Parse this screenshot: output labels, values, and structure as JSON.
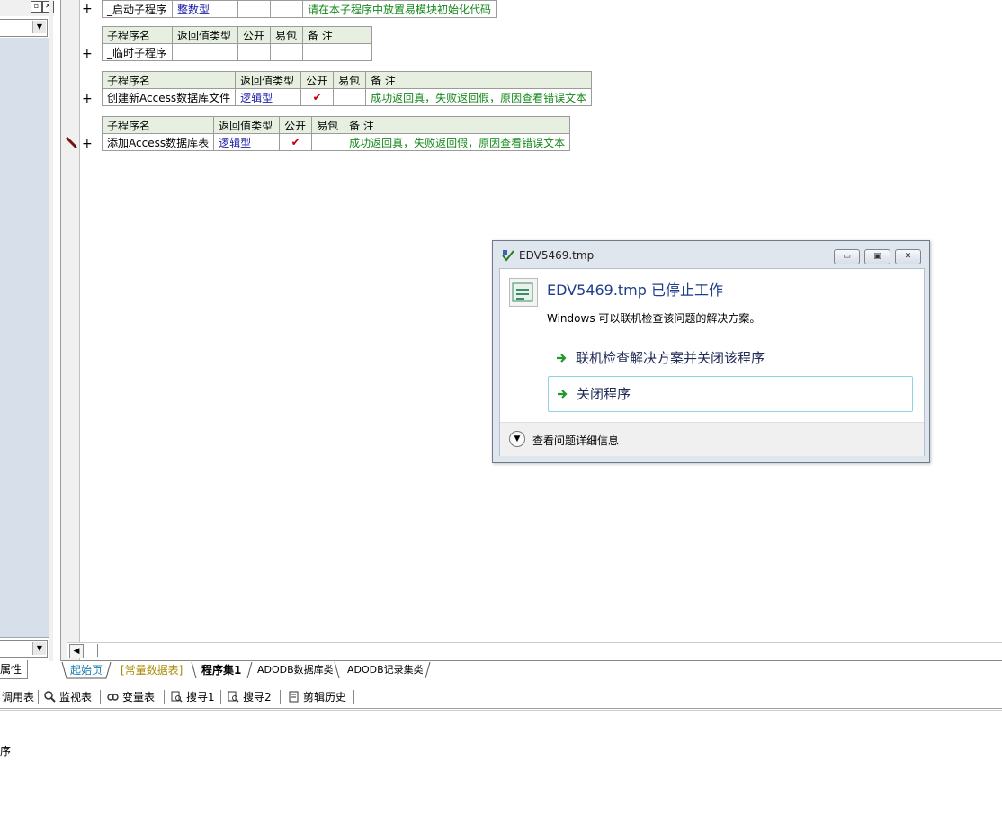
{
  "left_panel": {
    "properties_tab": "属性"
  },
  "subroutine_tables": [
    {
      "rows": [
        {
          "name": "_启动子程序",
          "return_type": "整数型",
          "public": "",
          "easy_pkg": "",
          "remark": "请在本子程序中放置易模块初始化代码"
        }
      ]
    },
    {
      "headers": [
        "子程序名",
        "返回值类型",
        "公开",
        "易包",
        "备 注"
      ],
      "rows": [
        {
          "name": "_临时子程序",
          "return_type": "",
          "public": "",
          "easy_pkg": "",
          "remark": ""
        }
      ]
    },
    {
      "headers": [
        "子程序名",
        "返回值类型",
        "公开",
        "易包",
        "备 注"
      ],
      "rows": [
        {
          "name": "创建新Access数据库文件",
          "return_type": "逻辑型",
          "public": "✔",
          "easy_pkg": "",
          "remark": "成功返回真，失败返回假，原因查看错误文本"
        }
      ]
    },
    {
      "headers": [
        "子程序名",
        "返回值类型",
        "公开",
        "易包",
        "备 注"
      ],
      "rows": [
        {
          "name": "添加Access数据库表",
          "return_type": "逻辑型",
          "public": "✔",
          "easy_pkg": "",
          "remark": "成功返回真，失败返回假，原因查看错误文本"
        }
      ]
    }
  ],
  "expand_symbol": "+",
  "editor_tabs": [
    "起始页",
    "[常量数据表]",
    "程序集1",
    "ADODB数据库类",
    "ADODB记录集类"
  ],
  "bottom_toolbar": [
    "调用表",
    "监视表",
    "变量表",
    "搜寻1",
    "搜寻2",
    "剪辑历史"
  ],
  "bottom_panel_text": "序",
  "dialog": {
    "title": "EDV5469.tmp",
    "heading": "EDV5469.tmp 已停止工作",
    "message": "Windows 可以联机检查该问题的解决方案。",
    "option1": "联机检查解决方案并关闭该程序",
    "option2": "关闭程序",
    "details": "查看问题详细信息"
  }
}
